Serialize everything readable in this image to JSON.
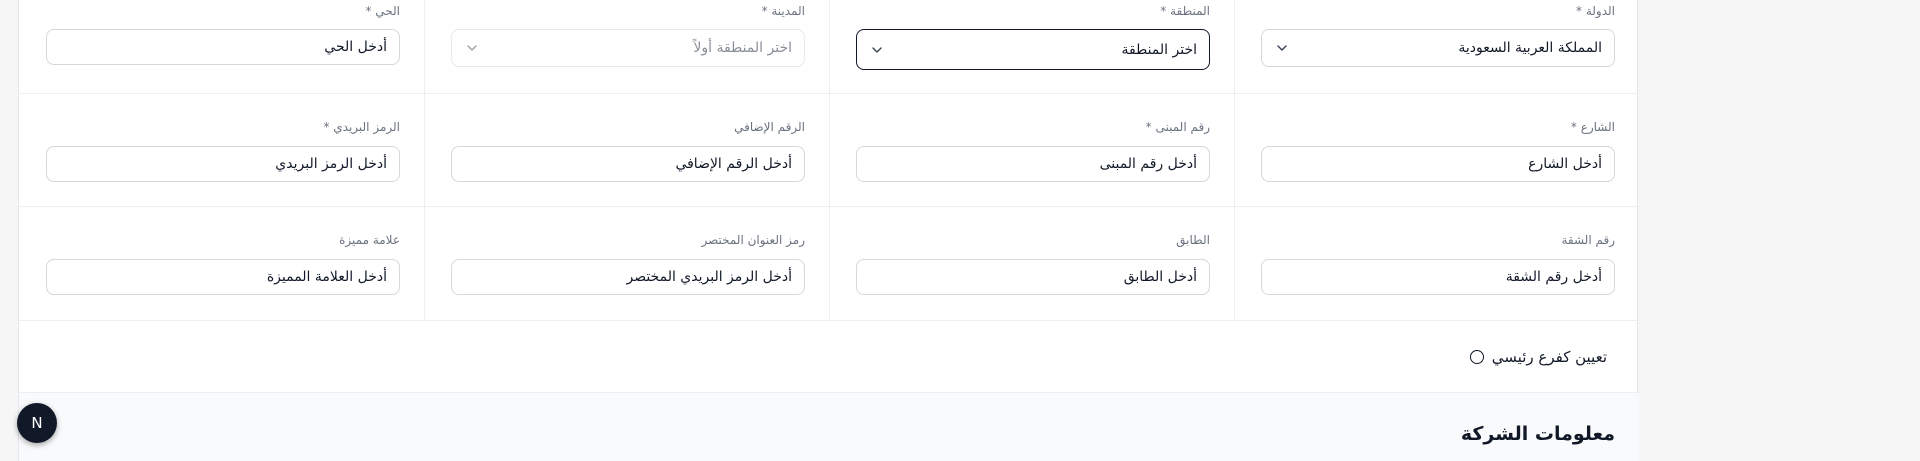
{
  "address": {
    "country": {
      "label": "الدولة *",
      "value": "المملكة العربية السعودية"
    },
    "region": {
      "label": "المنطقة *",
      "value": "اختر المنطقة"
    },
    "city": {
      "label": "المدينة *",
      "value": "اختر المنطقة أولاً"
    },
    "district": {
      "label": "الحي *",
      "value": "أدخل الحي"
    },
    "street": {
      "label": "الشارع *",
      "value": "أدخل الشارع"
    },
    "building_number": {
      "label": "رقم المبنى *",
      "value": "أدخل رقم المبنى"
    },
    "additional_number": {
      "label": "الرقم الإضافي",
      "value": "أدخل الرقم الإضافي"
    },
    "postal_code": {
      "label": "الرمز البريدي *",
      "value": "أدخل الرمز البريدي"
    },
    "apartment_number": {
      "label": "رقم الشقة",
      "value": "أدخل رقم الشقة"
    },
    "floor": {
      "label": "الطابق",
      "value": "أدخل الطابق"
    },
    "short_address": {
      "label": "رمز العنوان المختصر",
      "value": "أدخل الرمز البريدي المختصر"
    },
    "landmark": {
      "label": "علامة مميزة",
      "value": "أدخل العلامة المميزة"
    }
  },
  "main_branch": {
    "label": "تعيين كفرع رئيسي",
    "checked": false
  },
  "company_section": {
    "title": "معلومات الشركة"
  },
  "fab": {
    "letter": "N"
  },
  "icons": {
    "select": "chevron-down-icon",
    "fab": "next-logo-icon"
  },
  "colors": {
    "text": "#111827",
    "border": "#d4d7dd",
    "muted": "#6b7280",
    "fab": "#111827"
  }
}
